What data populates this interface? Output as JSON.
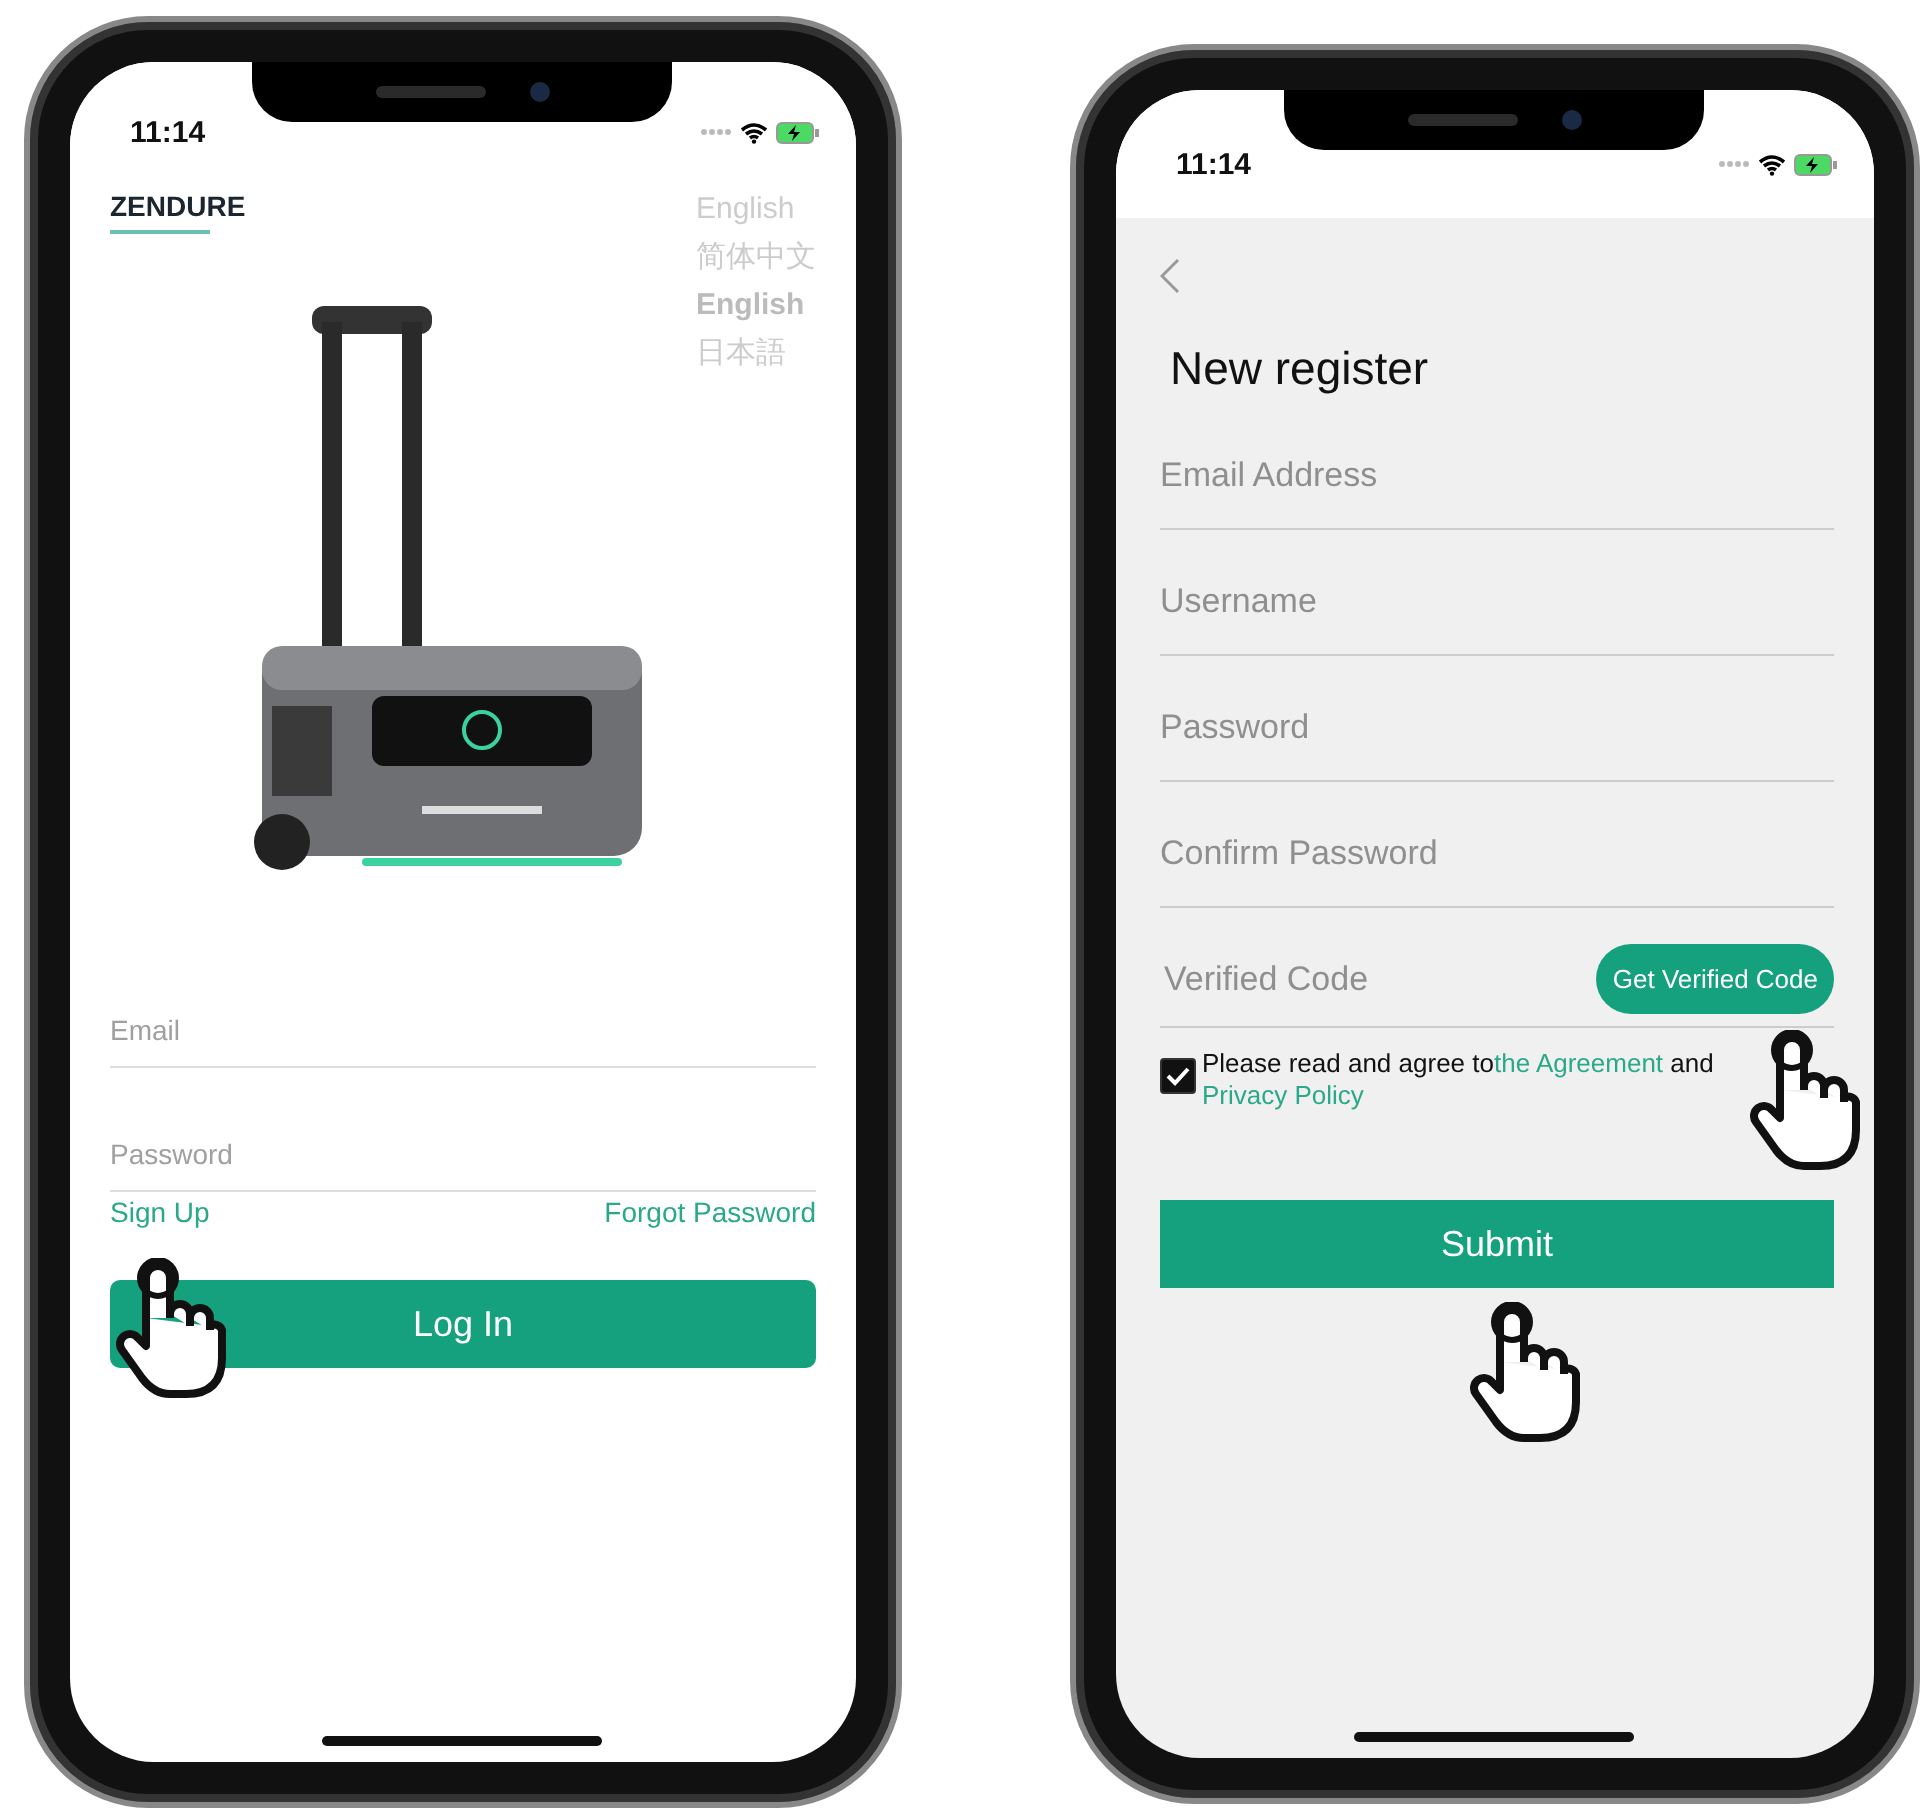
{
  "phones": [
    {
      "kind": "login",
      "status_time": "11:14",
      "logo": "ZENDURE",
      "languages": [
        {
          "label": "English",
          "selected": false
        },
        {
          "label": "简体中文",
          "selected": false
        },
        {
          "label": "English",
          "selected": true
        },
        {
          "label": "日本語",
          "selected": false
        }
      ],
      "fields": [
        {
          "placeholder": "Email"
        },
        {
          "placeholder": "Password"
        }
      ],
      "links": [
        "Sign Up",
        "Forgot Password"
      ],
      "button": "Log In"
    },
    {
      "kind": "register",
      "status_time": "11:14",
      "title": "New register",
      "fields": [
        {
          "placeholder": "Email Address"
        },
        {
          "placeholder": "Username"
        },
        {
          "placeholder": "Password"
        },
        {
          "placeholder": "Confirm Password"
        },
        {
          "placeholder": "Verified Code",
          "action": "Get Verified Code"
        }
      ],
      "agreement": {
        "checked": true,
        "text": "Please read and agree to",
        "link_1": "the Agreement",
        "middle": "and",
        "link_2": "Privacy Policy"
      },
      "button": "Submit"
    }
  ]
}
